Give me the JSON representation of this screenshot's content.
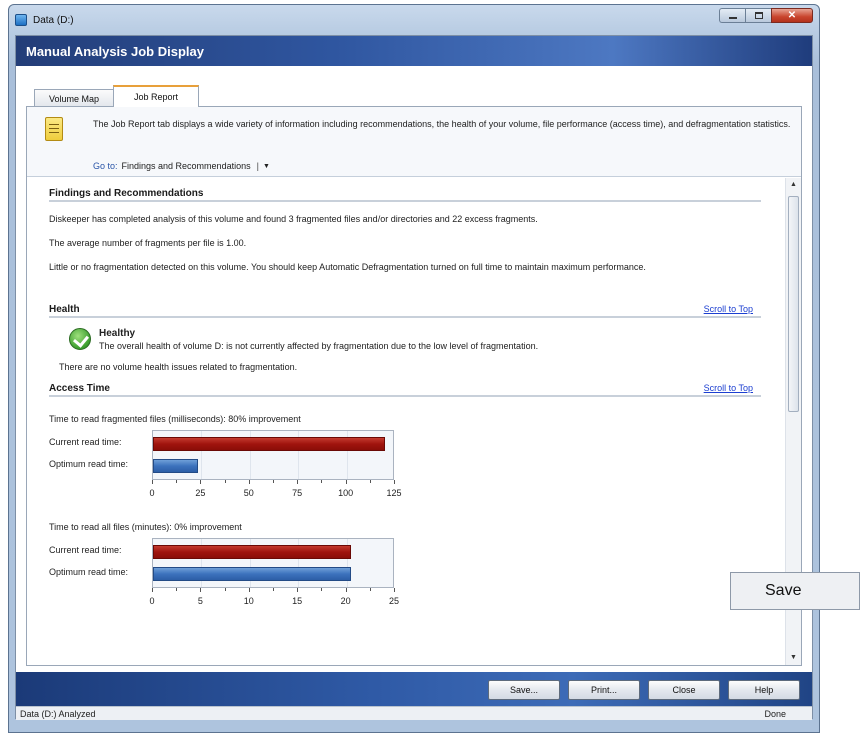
{
  "window": {
    "title": "Data (D:)"
  },
  "header": {
    "title": "Manual Analysis Job Display"
  },
  "tabs": [
    {
      "label": "Volume Map"
    },
    {
      "label": "Job Report"
    }
  ],
  "info": {
    "text": "The Job Report tab displays a wide variety of information including recommendations, the health of your volume, file performance (access time), and defragmentation statistics.",
    "goto_label": "Go to:",
    "goto_value": "Findings and Recommendations"
  },
  "findings": {
    "title": "Findings and Recommendations",
    "p1": "Diskeeper has completed analysis of this volume and found 3 fragmented files and/or directories and 22 excess fragments.",
    "p2": "The average number of fragments per file is 1.00.",
    "p3": "Little or no fragmentation detected on this volume. You should keep Automatic Defragmentation turned on full time to maintain maximum performance."
  },
  "health": {
    "title": "Health",
    "scroll_top": "Scroll to Top",
    "status": "Healthy",
    "desc": "The overall health of volume D: is not currently affected by fragmentation due to the low level of fragmentation.",
    "note": "There are no volume health issues related to fragmentation."
  },
  "access_time": {
    "title": "Access Time",
    "scroll_top": "Scroll to Top"
  },
  "chart_data": [
    {
      "type": "bar",
      "title": "Time to read fragmented files (milliseconds): 80% improvement",
      "categories": [
        "Current read time:",
        "Optimum read time:"
      ],
      "values": [
        120,
        23
      ],
      "xlim": [
        0,
        125
      ],
      "xticks": [
        0,
        25,
        50,
        75,
        100,
        125
      ]
    },
    {
      "type": "bar",
      "title": "Time to read all files (minutes): 0% improvement",
      "categories": [
        "Current read time:",
        "Optimum read time:"
      ],
      "values": [
        20.5,
        20.5
      ],
      "xlim": [
        0,
        25
      ],
      "xticks": [
        0,
        5,
        10,
        15,
        20,
        25
      ]
    }
  ],
  "colors": {
    "current_bar": "#a0140e",
    "optimum_bar": "#3c72bd"
  },
  "footer": {
    "save": "Save...",
    "print": "Print...",
    "close": "Close",
    "help": "Help"
  },
  "popup": {
    "label": "Save"
  },
  "status": {
    "left": "Data (D:) Analyzed",
    "right": "Done"
  }
}
